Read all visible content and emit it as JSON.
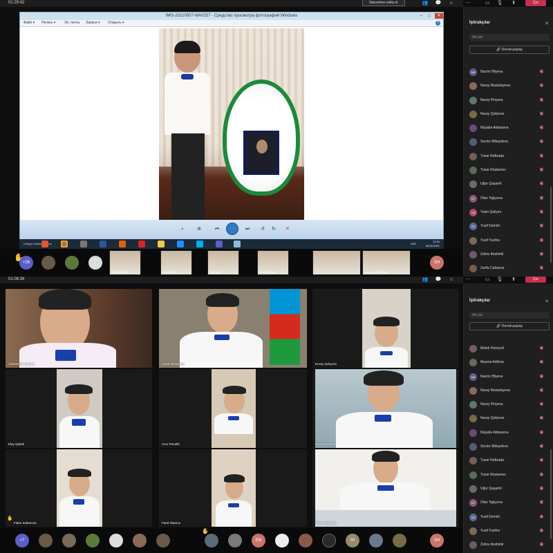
{
  "top": {
    "time": "01:29:42",
    "share_button": "İdarəetmə xahiş et",
    "leave_button": "Çıx",
    "viewer": {
      "title": "IMG-20210507-WA0257 - Средство просмотра фотографий Windows",
      "menu": [
        "Файл ▾",
        "Печать ▾",
        "Эл. почта",
        "Записи ▾",
        "Открыть ▾"
      ],
      "help": "?"
    },
    "taskbar": {
      "presenter": "Ulviyya Xudaverdiyeva",
      "lang": "AZE",
      "clock_time": "12:30",
      "clock_date": "08.05.2021"
    },
    "panel": {
      "title": "İştirakçılar",
      "search_placeholder": "Ad yaz",
      "invite": "Dəvəti paylaş",
      "participants": [
        {
          "initials": "NƏ",
          "name": "Nazrin Əliyeva",
          "color": "#6a5a8a"
        },
        {
          "initials": "",
          "name": "Nuray Mustafayeva",
          "color": "#8a6a5a"
        },
        {
          "initials": "",
          "name": "Nuray Piriyeva",
          "color": "#5a7a6a"
        },
        {
          "initials": "",
          "name": "Nuray Quliyeva",
          "color": "#7a6a4a"
        },
        {
          "initials": "",
          "name": "Nüşabə Abbasova",
          "color": "#6a4a7a"
        },
        {
          "initials": "",
          "name": "Sevinc Mikayilova",
          "color": "#5a5a7a"
        },
        {
          "initials": "",
          "name": "Tunar Rafizada",
          "color": "#7a5a5a"
        },
        {
          "initials": "",
          "name": "Tunar Rüstamov",
          "color": "#5a6a5a"
        },
        {
          "initials": "",
          "name": "Uğur Qaşamli",
          "color": "#6a6a6a"
        },
        {
          "initials": "ÜT",
          "name": "Ültar Tağıyeva",
          "color": "#8a5a7a"
        },
        {
          "initials": "YQ",
          "name": "Yasin Quliyev",
          "color": "#b04a6a"
        },
        {
          "initials": "YD",
          "name": "Yusif Demirli",
          "color": "#5a6a9a"
        },
        {
          "initials": "",
          "name": "Yusif Yusifov",
          "color": "#7a6a5a"
        },
        {
          "initials": "",
          "name": "Zahra Ibrahimli",
          "color": "#6a5a6a"
        },
        {
          "initials": "",
          "name": "Zarifa Cafarova",
          "color": "#7a5a4a"
        }
      ]
    },
    "strip": {
      "raised_count": "+26",
      "thumbs": [
        "Nazrin Əliyeva",
        "Fərid Qafarov",
        "Yusif Əliyev",
        "Tunar Rüstamov",
        "Ulviyya Xudaverdiyeva"
      ],
      "sh": "SH"
    }
  },
  "bottom": {
    "time": "01:08:36",
    "leave_button": "Çıx",
    "panel": {
      "title": "İştirakçılar",
      "search_placeholder": "Ad yaz",
      "invite": "Dəvəti paylaş",
      "participants": [
        {
          "initials": "",
          "name": "Məlek Hüseynli",
          "color": "#7a5a6a"
        },
        {
          "initials": "",
          "name": "Masma Adilova",
          "color": "#6a6a5a"
        },
        {
          "initials": "NƏ",
          "name": "Nazrin Əliyeva",
          "color": "#6a5a8a"
        },
        {
          "initials": "",
          "name": "Nuray Mustafayeva",
          "color": "#8a6a5a"
        },
        {
          "initials": "",
          "name": "Nuray Piriyeva",
          "color": "#5a7a6a"
        },
        {
          "initials": "",
          "name": "Nuray Quliyeva",
          "color": "#7a6a4a"
        },
        {
          "initials": "",
          "name": "Nüşabə Abbasova",
          "color": "#6a4a7a"
        },
        {
          "initials": "",
          "name": "Sevinc Mikayilova",
          "color": "#5a5a7a"
        },
        {
          "initials": "",
          "name": "Tunar Rafizada",
          "color": "#7a5a5a"
        },
        {
          "initials": "",
          "name": "Tunar Rüstamov",
          "color": "#5a6a5a"
        },
        {
          "initials": "",
          "name": "Uğur Qaşamli",
          "color": "#6a6a6a"
        },
        {
          "initials": "ÜT",
          "name": "Ültar Tağıyeva",
          "color": "#8a5a7a"
        },
        {
          "initials": "YD",
          "name": "Yusif Demirli",
          "color": "#5a6a9a"
        },
        {
          "initials": "",
          "name": "Yusif Yusifov",
          "color": "#7a6a5a"
        },
        {
          "initials": "",
          "name": "Zahra Ibrahimli",
          "color": "#6a5a6a"
        }
      ]
    },
    "tiles": [
      {
        "name": "Abdulməlik Qarlıov",
        "bg": "#7a5a4a"
      },
      {
        "name": "Tunar Rüstamov",
        "bg": "#8a8070"
      },
      {
        "name": "Nuray Quliyeva",
        "bg": "#d8d2c8"
      },
      {
        "name": "Elay Qafarli",
        "bg": "#cfcac2"
      },
      {
        "name": "Arzu Penahli",
        "bg": "#d6c9b6"
      },
      {
        "name": "Nazrin Əliyeva",
        "bg": "#b9c9cf"
      },
      {
        "name": "Fidan Sultanova",
        "bg": "#e4ddd2"
      },
      {
        "name": "Farid İslamov",
        "bg": "#e0d2c2"
      },
      {
        "name": "Tunar Rafizada",
        "bg": "#f2f0ec"
      }
    ],
    "strip": {
      "raised_count": "+7",
      "em": "EM",
      "ih": "İH",
      "sh": "SH"
    }
  },
  "colors": {
    "teams_dark": "#1f1f1f",
    "leave_red": "#c4314b",
    "viewer_blue": "#cde0f0"
  }
}
